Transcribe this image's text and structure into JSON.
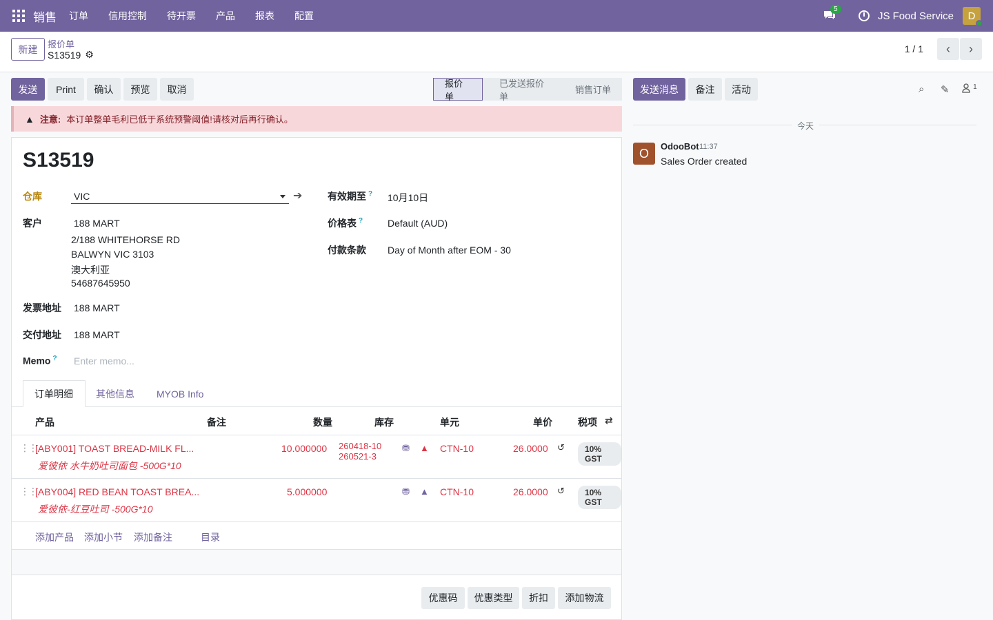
{
  "nav": {
    "brand": "销售",
    "menu": [
      "订单",
      "信用控制",
      "待开票",
      "产品",
      "报表",
      "配置"
    ],
    "chat_count": "5",
    "company": "JS Food Service",
    "avatar_letter": "D"
  },
  "control": {
    "new_label": "新建",
    "breadcrumb_parent": "报价单",
    "breadcrumb_current": "S13519",
    "pager": "1 / 1"
  },
  "actions": {
    "send": "发送",
    "print": "Print",
    "confirm": "确认",
    "preview": "预览",
    "cancel": "取消"
  },
  "status_stages": [
    "报价单",
    "已发送报价单",
    "销售订单"
  ],
  "alert": {
    "title": "注意:",
    "message": "本订单整单毛利已低于系统预警阈值!请核对后再行确认。"
  },
  "form": {
    "name": "S13519",
    "warehouse_label": "仓库",
    "warehouse": "VIC",
    "customer_label": "客户",
    "customer_name": "188 MART",
    "customer_address": [
      "2/188 WHITEHORSE RD",
      "BALWYN VIC 3103",
      "澳大利亚",
      "54687645950"
    ],
    "invoice_label": "发票地址",
    "invoice_value": "188 MART",
    "delivery_label": "交付地址",
    "delivery_value": "188 MART",
    "memo_label": "Memo",
    "memo_placeholder": "Enter memo...",
    "validity_label": "有效期至",
    "validity_value": "10月10日",
    "pricelist_label": "价格表",
    "pricelist_value": "Default (AUD)",
    "payment_label": "付款条款",
    "payment_value": "Day of Month after EOM - 30"
  },
  "tabs": [
    "订单明细",
    "其他信息",
    "MYOB Info"
  ],
  "table": {
    "headers": [
      "产品",
      "备注",
      "数量",
      "库存",
      "单元",
      "单价",
      "税项"
    ],
    "rows": [
      {
        "product": "[ABY001] TOAST BREAD-MILK FL...",
        "description": "爱彼依 水牛奶吐司面包 -500G*10",
        "qty": "10.000000",
        "stock": [
          "260418-10",
          "260521-3"
        ],
        "uom": "CTN-10",
        "price": "26.0000",
        "tax": "10% GST"
      },
      {
        "product": "[ABY004] RED BEAN TOAST BREA...",
        "description": "爱彼依-红豆吐司 -500G*10",
        "qty": "5.000000",
        "stock": [],
        "uom": "CTN-10",
        "price": "26.0000",
        "tax": "10% GST"
      }
    ],
    "add_links": [
      "添加产品",
      "添加小节",
      "添加备注",
      "目录"
    ]
  },
  "bottom_buttons": [
    "优惠码",
    "优惠类型",
    "折扣",
    "添加物流"
  ],
  "chatter": {
    "send_message": "发送消息",
    "note": "备注",
    "activity": "活动",
    "followers": "1",
    "today": "今天",
    "messages": [
      {
        "avatar": "O",
        "author": "OdooBot",
        "time": "11:37",
        "body": "Sales Order created"
      }
    ]
  },
  "colors": {
    "brand": "#71639e",
    "danger": "#dc3545",
    "alert_bg": "#f8d7da"
  }
}
